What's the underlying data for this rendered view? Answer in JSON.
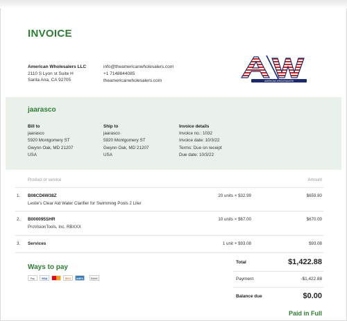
{
  "invoice": {
    "title": "INVOICE",
    "company": {
      "name": "American Wholesalers LLC",
      "address1": "2110 S Lyon st Suite H",
      "address2": "Santa Ana, CA 92705"
    },
    "contact": {
      "email": "info@theamericanwholesalers.com",
      "phone": "+1 7148844085",
      "website": "theamericanwholesalers.com"
    },
    "logo": {
      "text": "AW",
      "subtext": "AMERICAN WHOLESALERS"
    },
    "customer_name": "jaarasco",
    "bill_to": {
      "heading": "Bill to",
      "name": "jaarasco",
      "line1": "5920 Montgomery ST",
      "line2": "Gwynn Oak, MD 21207",
      "country": "USA"
    },
    "ship_to": {
      "heading": "Ship to",
      "name": "jaarasco",
      "line1": "5920 Montgomery ST",
      "line2": "Gwynn Oak, MD 21207",
      "country": "USA"
    },
    "details": {
      "heading": "Invoice details",
      "number": "Invoice no.: 1032",
      "date": "Invoice date: 10/3/22",
      "terms": "Terms: Due on receipt",
      "due": "Due date: 10/3/22"
    },
    "table": {
      "product_header": "Product or service",
      "amount_header": "Amount",
      "rows": [
        {
          "num": "1.",
          "title": "B08CD6W38Z",
          "desc": "Leslie's Clear Aid Water Clarifier for Swimming Pools 2 Liter",
          "qty": "20 units × $32.99",
          "amount": "$659.80"
        },
        {
          "num": "2.",
          "title": "B000095SHR",
          "desc": "ProVisionTools, Inc. RBXXX",
          "qty": "10 units × $67.00",
          "amount": "$670.00"
        },
        {
          "num": "3.",
          "title": "Services",
          "desc": "",
          "qty": "1 unit × $93.08",
          "amount": "$93.08"
        }
      ]
    },
    "ways_to_pay": "Ways to pay",
    "payment_icons": [
      "apple-pay-icon",
      "visa-icon",
      "mastercard-icon",
      "discover-icon",
      "amex-icon",
      "bank-icon"
    ],
    "payment_icon_labels": {
      "apple": "Pay",
      "visa": "VISA",
      "disc": "DISC",
      "amex": "AMEX",
      "bank": "BANK"
    },
    "summary": {
      "total_label": "Total",
      "total_value": "$1,422.88",
      "payment_label": "Payment",
      "payment_value": "-$1,422.88",
      "balance_label": "Balance due",
      "balance_value": "$0.00"
    },
    "status": "Paid in Full",
    "colors": {
      "accent": "#2e7d32",
      "band": "#e9f1ea"
    }
  }
}
